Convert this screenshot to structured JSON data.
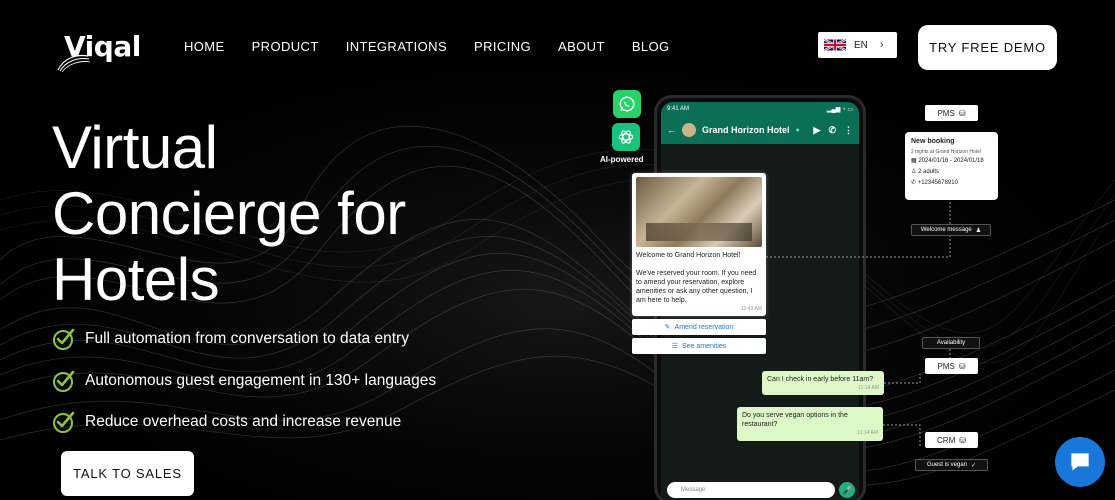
{
  "brand": {
    "name": "Viqal"
  },
  "nav": {
    "items": [
      "HOME",
      "PRODUCT",
      "INTEGRATIONS",
      "PRICING",
      "ABOUT",
      "BLOG"
    ],
    "language": "EN",
    "cta": "TRY FREE DEMO"
  },
  "hero": {
    "title_lines": [
      "Virtual",
      "Concierge for",
      "Hotels"
    ],
    "features": [
      "Full automation from conversation to data entry",
      "Autonomous guest engagement in 130+ languages",
      "Reduce overhead costs and increase revenue"
    ],
    "cta": "TALK TO SALES"
  },
  "visual": {
    "ai_label": "AI-powered",
    "phone": {
      "status_time": "9:41 AM",
      "hotel_name": "Grand Horizon Hotel",
      "welcome_message": "Welcome to Grand Horizon Hotel!\n\nWe've reserved your room. If you need to amend your reservation, explore amenities or ask any other question, I am here to help.",
      "welcome_time": "10:43 AM",
      "button_amend": "Amend reservation",
      "button_amenities": "See amenities",
      "msg_checkin": "Can I check in early before 11am?",
      "msg_checkin_time": "11:14 AM",
      "msg_vegan": "Do you serve vegan options in the restaurant?",
      "msg_vegan_time": "11:14 AM",
      "input_placeholder": "Message"
    },
    "pms_label": "PMS",
    "booking": {
      "title": "New booking",
      "subtitle": "2 nights at Grand Horizon Hotel",
      "dates": "2024/01/16 - 2024/01/18",
      "guests": "2 adults",
      "phone": "+12345678910"
    },
    "welcome_tag": "Welcome message",
    "availability_tag": "Availability",
    "pms_label_2": "PMS",
    "crm_label": "CRM",
    "vegan_tag": "Guest is vegan"
  },
  "colors": {
    "background": "#000000",
    "check": "#8cc63f",
    "whatsapp": "#25d366",
    "chat_fab": "#1877d8"
  }
}
